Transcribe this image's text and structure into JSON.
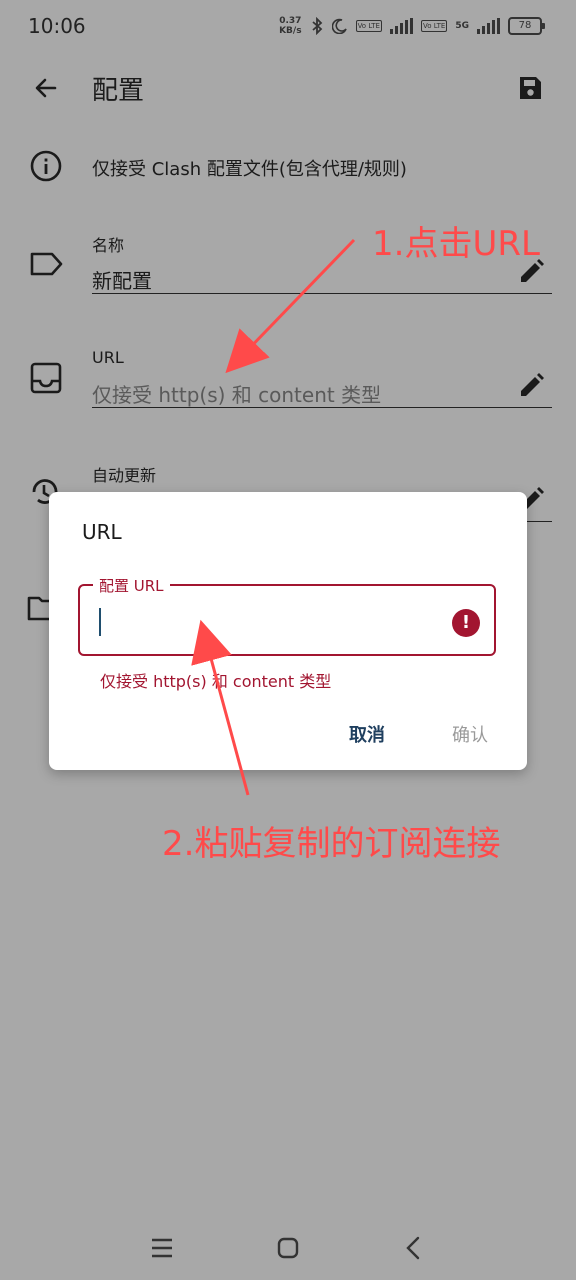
{
  "status_bar": {
    "time": "10:06",
    "net_speed_value": "0.37",
    "net_speed_unit": "KB/s",
    "volte1": "Vo LTE",
    "volte2": "Vo LTE",
    "network": "5G",
    "battery": "78"
  },
  "app_bar": {
    "title": "配置",
    "back_icon": "arrow-left-icon",
    "save_icon": "save-icon"
  },
  "info_row": {
    "text": "仅接受 Clash 配置文件(包含代理/规则)",
    "icon": "info-icon"
  },
  "name_field": {
    "label": "名称",
    "value": "新配置",
    "icon": "label-tag-icon",
    "edit_icon": "pencil-icon"
  },
  "url_field": {
    "label": "URL",
    "placeholder": "仅接受 http(s) 和 content 类型",
    "icon": "inbox-icon",
    "edit_icon": "pencil-icon"
  },
  "auto_update_field": {
    "label": "自动更新",
    "icon": "history-icon",
    "edit_icon": "pencil-icon"
  },
  "folder_row": {
    "icon": "folder-icon"
  },
  "dialog": {
    "title": "URL",
    "field_label": "配置 URL",
    "field_value": "",
    "error_icon": "error-icon",
    "error_text": "仅接受 http(s) 和 content 类型",
    "cancel": "取消",
    "confirm": "确认"
  },
  "annotations": {
    "step1": "1.点击URL",
    "step2": "2.粘贴复制的订阅连接",
    "color": "#ff4a4a"
  },
  "colors": {
    "background": "#a8a8a8",
    "error": "#a21530",
    "accent": "#1f3f5f"
  },
  "nav_bar": {
    "menu_icon": "menu-icon",
    "home_icon": "home-icon",
    "back_icon": "back-chevron-icon"
  }
}
